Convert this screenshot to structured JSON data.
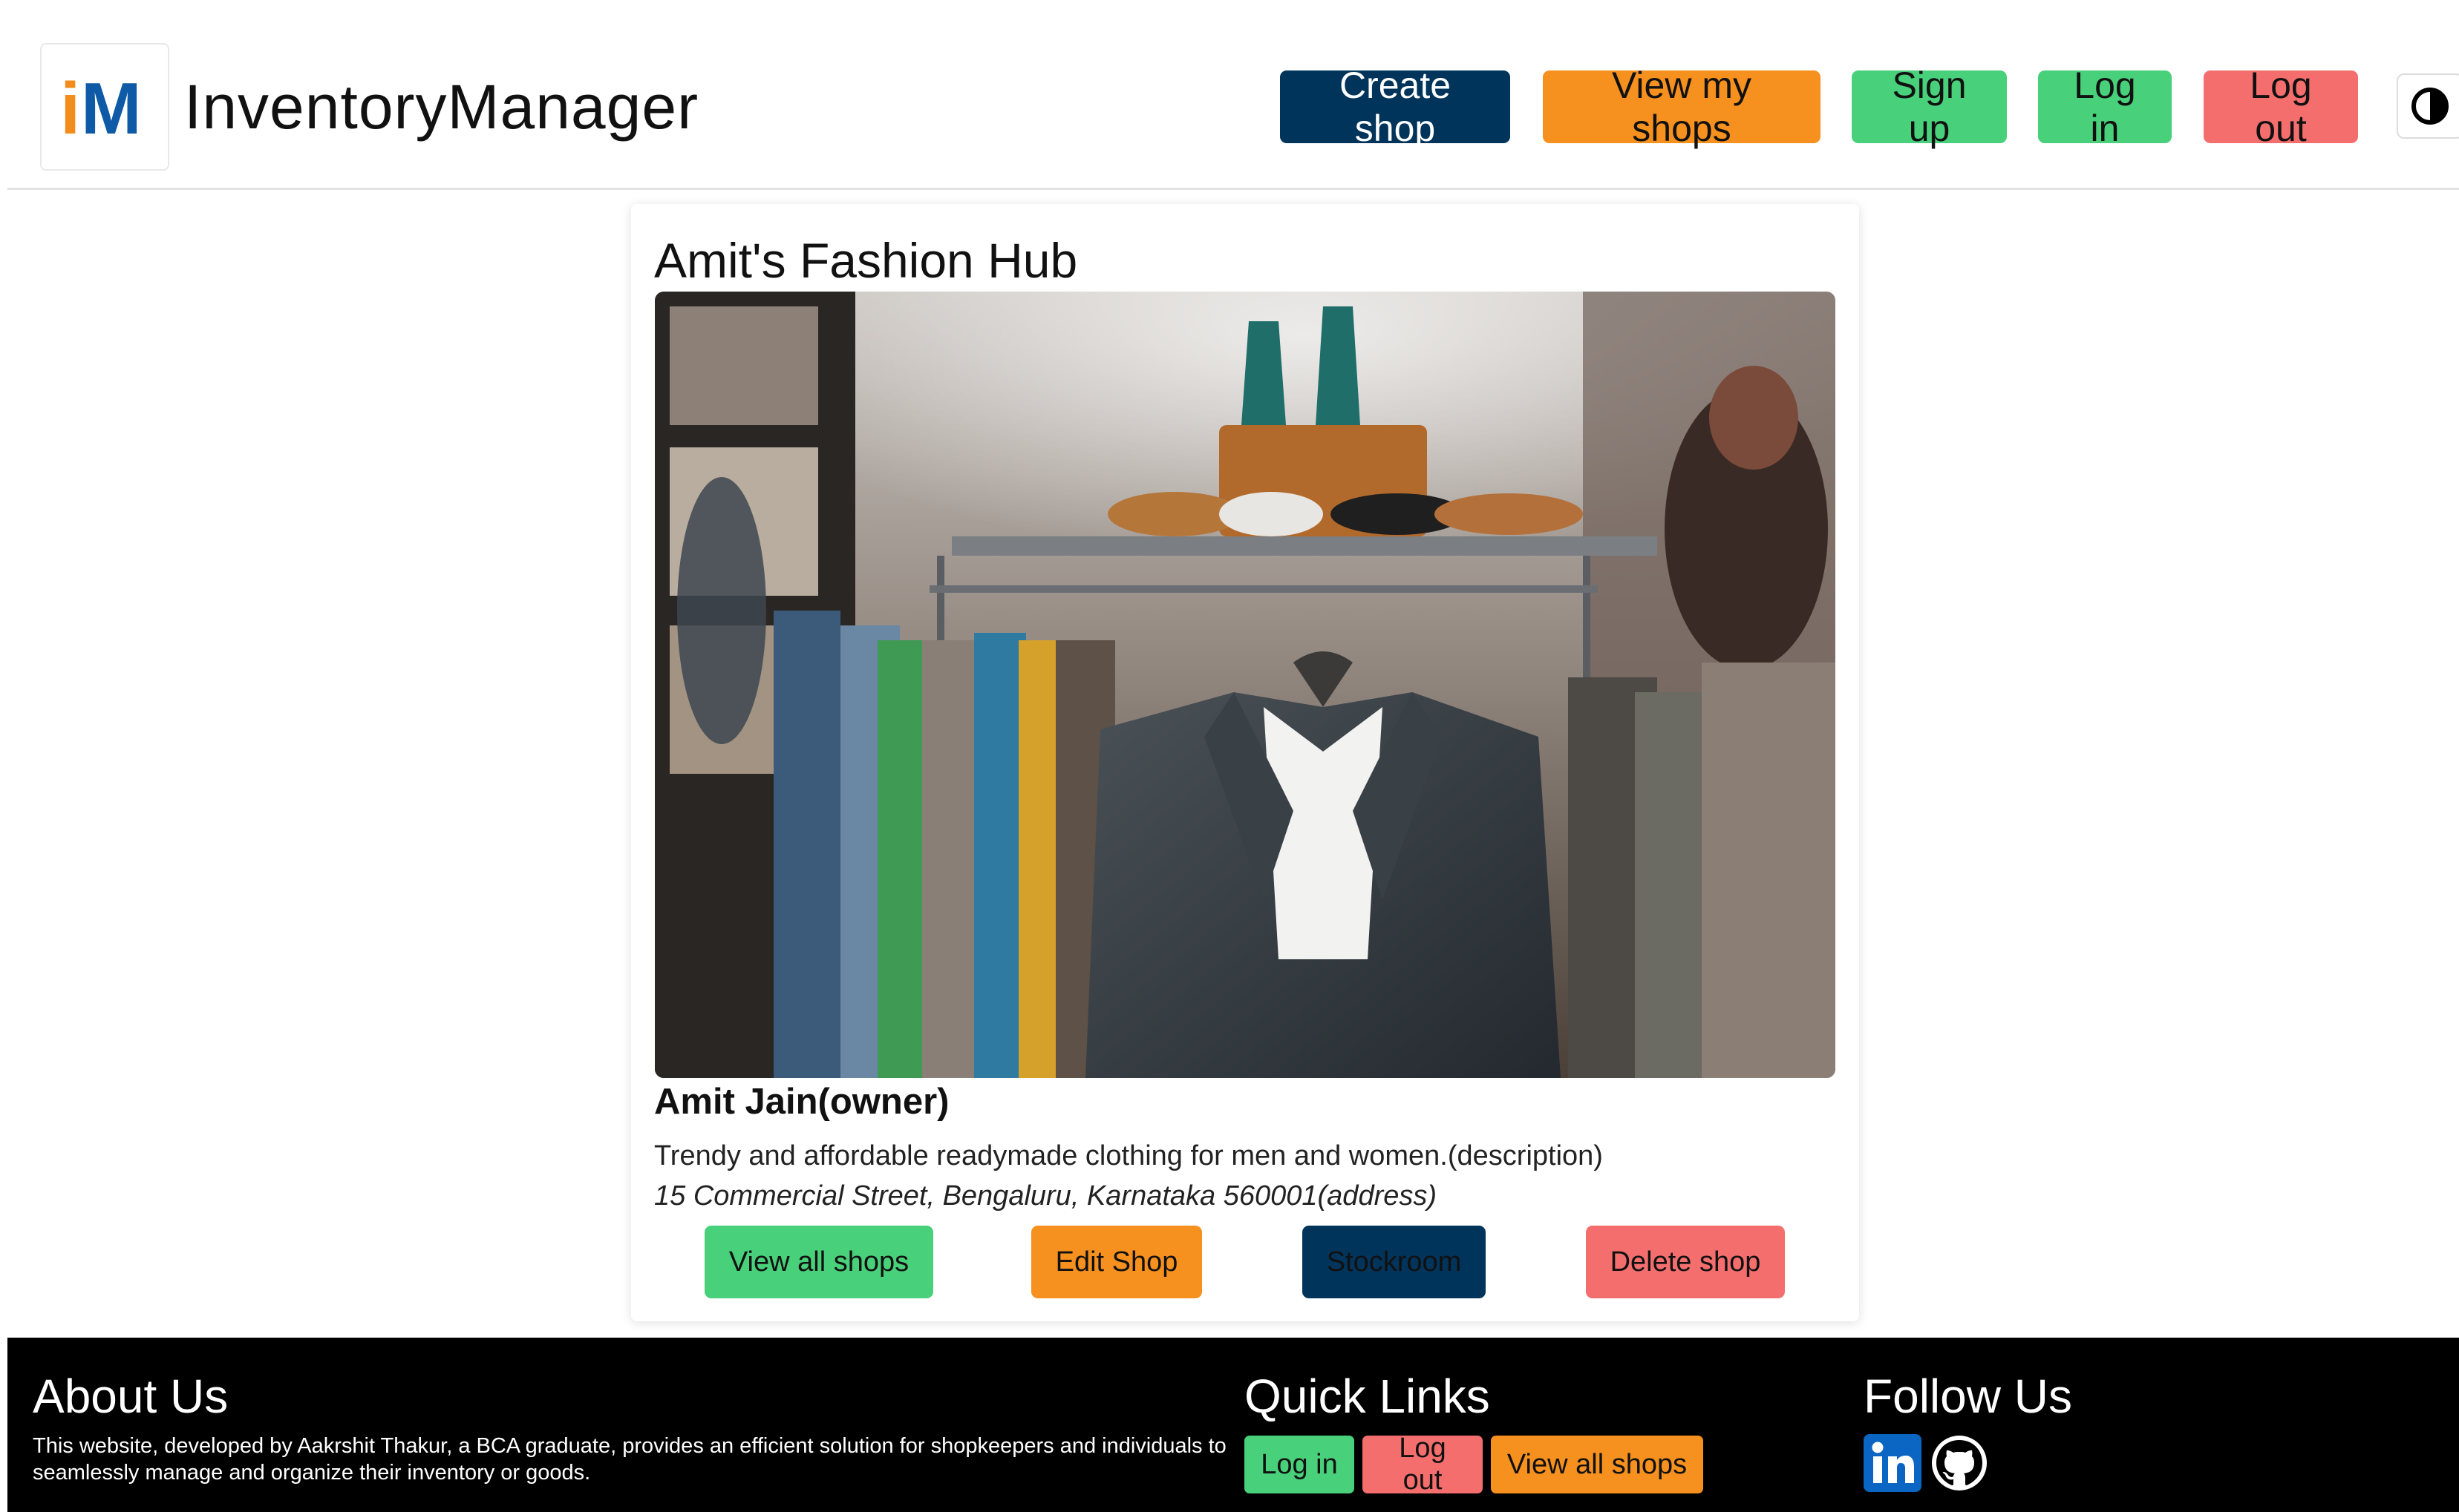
{
  "brand": {
    "logo_text_i": "i",
    "logo_text_m": "M",
    "name": "InventoryManager"
  },
  "nav": {
    "create_shop": "Create shop",
    "view_my_shops": "View my shops",
    "sign_up": "Sign up",
    "log_in": "Log in",
    "log_out": "Log out",
    "theme_toggle_icon": "contrast-icon"
  },
  "shop": {
    "title": "Amit's Fashion Hub",
    "image_icon": "clothing-store-photo",
    "owner": "Amit Jain(owner)",
    "description": "Trendy and affordable readymade clothing for men and women.(description)",
    "address": "15 Commercial Street, Bengaluru, Karnataka 560001(address)",
    "buttons": {
      "view_all": "View all shops",
      "edit": "Edit Shop",
      "stockroom": "Stockroom",
      "delete": "Delete shop"
    }
  },
  "footer": {
    "about_title": "About Us",
    "about_text": "This website, developed by Aakrshit Thakur, a BCA graduate, provides an efficient solution for shopkeepers and individuals to seamlessly manage and organize their inventory or goods.",
    "quick_links_title": "Quick Links",
    "quick_links": {
      "log_in": "Log in",
      "log_out": "Log out",
      "view_all_shops": "View all shops"
    },
    "follow_title": "Follow Us",
    "social_icons": [
      "linkedin-icon",
      "github-icon"
    ]
  },
  "colors": {
    "navy": "#01345b",
    "orange": "#f6901e",
    "green": "#48d07a",
    "red": "#f46e6e",
    "logo_orange": "#f28c1a",
    "logo_blue": "#0f5aa6",
    "linkedin_blue": "#0a66c2"
  }
}
